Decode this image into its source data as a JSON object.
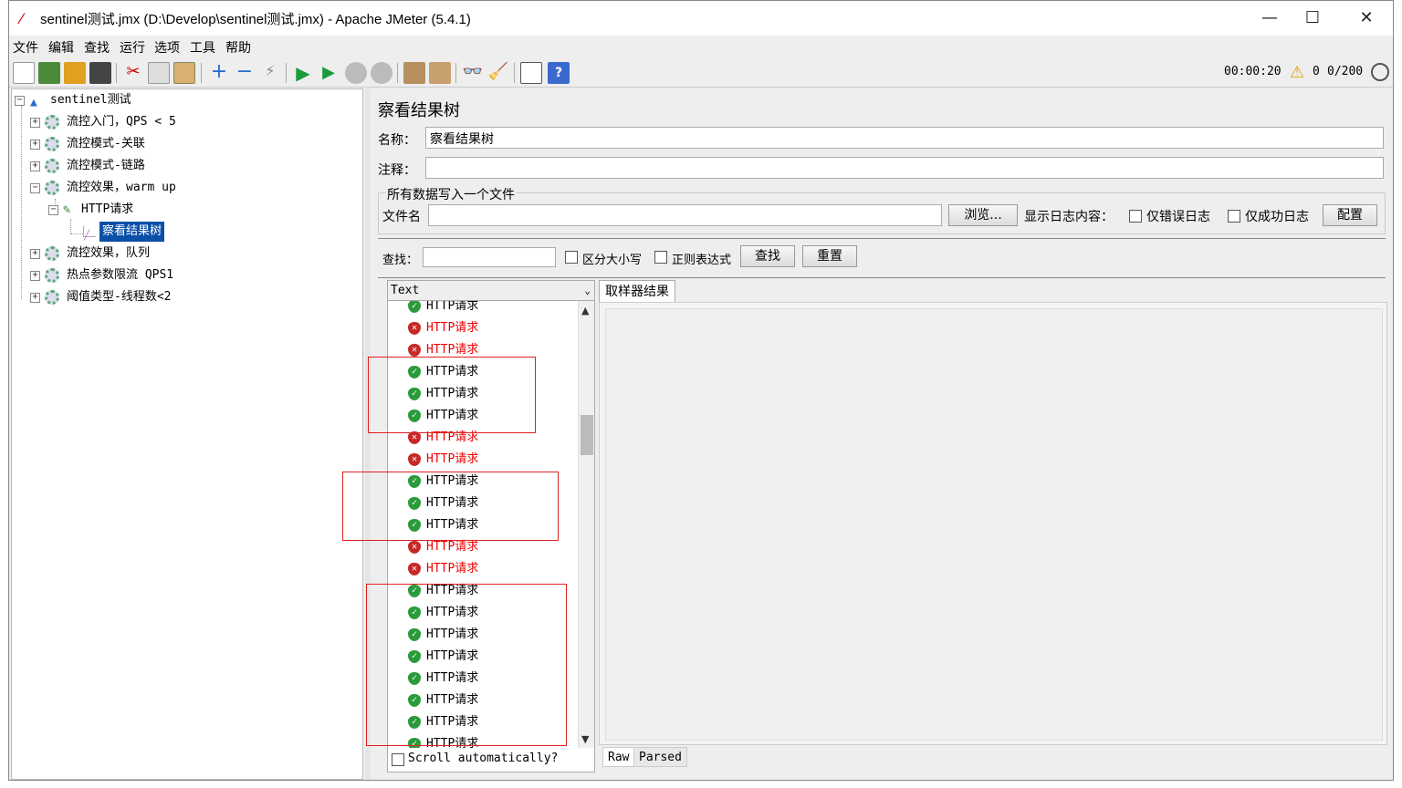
{
  "window": {
    "title": "sentinel测试.jmx (D:\\Develop\\sentinel测试.jmx) - Apache JMeter (5.4.1)",
    "minimize": "—",
    "maximize": "☐",
    "close": "✕"
  },
  "menu": [
    "文件",
    "编辑",
    "查找",
    "运行",
    "选项",
    "工具",
    "帮助"
  ],
  "status": {
    "timer": "00:00:20",
    "warnings": "0",
    "threads": "0/200"
  },
  "tree": {
    "root": "sentinel测试",
    "groups": [
      "流控入门，QPS < 5",
      "流控模式-关联",
      "流控模式-链路",
      "流控效果，warm up",
      "流控效果，队列",
      "热点参数限流 QPS1",
      "阈值类型-线程数<2"
    ],
    "sampler": "HTTP请求",
    "listener": "察看结果树"
  },
  "panel": {
    "heading": "察看结果树",
    "name_label": "名称：",
    "name_value": "察看结果树",
    "comment_label": "注释：",
    "comment_value": "",
    "file_group_title": "所有数据写入一个文件",
    "filename_label": "文件名",
    "filename_value": "",
    "browse": "浏览...",
    "log_content_label": "显示日志内容：",
    "errors_only": "仅错误日志",
    "success_only": "仅成功日志",
    "configure": "配置",
    "search_label": "查找：",
    "search_value": "",
    "case_sensitive": "区分大小写",
    "regex": "正则表达式",
    "find_button": "查找",
    "reset_button": "重置"
  },
  "results": {
    "renderer": "Text",
    "items": [
      {
        "label": "HTTP请求",
        "status": "ok"
      },
      {
        "label": "HTTP请求",
        "status": "error"
      },
      {
        "label": "HTTP请求",
        "status": "error"
      },
      {
        "label": "HTTP请求",
        "status": "ok"
      },
      {
        "label": "HTTP请求",
        "status": "ok"
      },
      {
        "label": "HTTP请求",
        "status": "ok"
      },
      {
        "label": "HTTP请求",
        "status": "error"
      },
      {
        "label": "HTTP请求",
        "status": "error"
      },
      {
        "label": "HTTP请求",
        "status": "ok"
      },
      {
        "label": "HTTP请求",
        "status": "ok"
      },
      {
        "label": "HTTP请求",
        "status": "ok"
      },
      {
        "label": "HTTP请求",
        "status": "error"
      },
      {
        "label": "HTTP请求",
        "status": "error"
      },
      {
        "label": "HTTP请求",
        "status": "ok"
      },
      {
        "label": "HTTP请求",
        "status": "ok"
      },
      {
        "label": "HTTP请求",
        "status": "ok"
      },
      {
        "label": "HTTP请求",
        "status": "ok"
      },
      {
        "label": "HTTP请求",
        "status": "ok"
      },
      {
        "label": "HTTP请求",
        "status": "ok"
      },
      {
        "label": "HTTP请求",
        "status": "ok"
      },
      {
        "label": "HTTP请求",
        "status": "ok"
      }
    ],
    "scroll_auto": "Scroll automatically?",
    "sampler_tab": "取样器结果",
    "raw_tab": "Raw",
    "parsed_tab": "Parsed"
  },
  "colors": {
    "selected": "#0a4fa8",
    "error_text": "#e00000",
    "ok_icon": "#2a9a3a",
    "error_icon": "#c62828",
    "highlight_box": "#e02020"
  }
}
